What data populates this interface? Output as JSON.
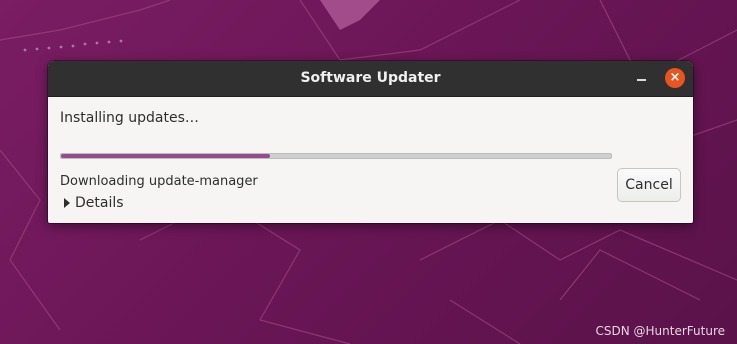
{
  "window": {
    "title": "Software Updater",
    "status_text": "Installing updates…",
    "progress": 0.38,
    "cancel_label": "Cancel",
    "download_text": "Downloading update-manager",
    "details_label": "Details"
  },
  "watermark": "CSDN @HunterFuture",
  "colors": {
    "accent": "#e95420",
    "progress": "#924d8b",
    "background": "#6b1657"
  },
  "icons": [
    "minimize-icon",
    "close-icon",
    "expander-triangle-icon"
  ]
}
